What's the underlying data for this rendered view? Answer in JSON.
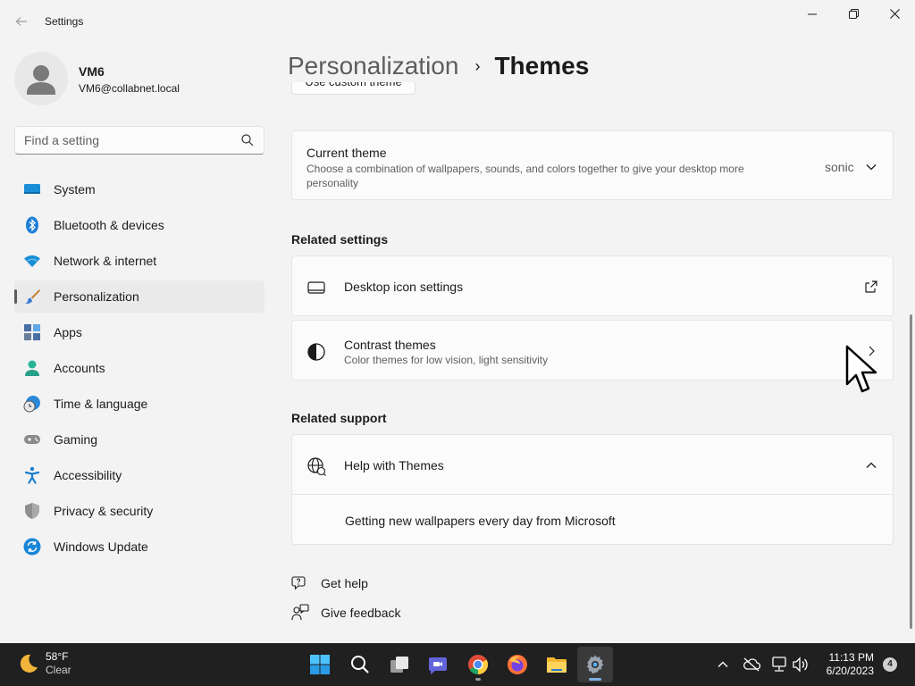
{
  "window": {
    "title": "Settings",
    "back_icon": "arrow-left-icon",
    "controls": [
      "minimize-icon",
      "maximize-icon",
      "close-icon"
    ]
  },
  "profile": {
    "name": "VM6",
    "email": "VM6@collabnet.local"
  },
  "search": {
    "placeholder": "Find a setting",
    "value": ""
  },
  "sidebar": {
    "items": [
      {
        "label": "System",
        "icon": "system-monitor-icon"
      },
      {
        "label": "Bluetooth & devices",
        "icon": "bluetooth-icon"
      },
      {
        "label": "Network & internet",
        "icon": "wifi-icon"
      },
      {
        "label": "Personalization",
        "icon": "paintbrush-icon",
        "active": true
      },
      {
        "label": "Apps",
        "icon": "apps-icon"
      },
      {
        "label": "Accounts",
        "icon": "accounts-icon"
      },
      {
        "label": "Time & language",
        "icon": "clock-globe-icon"
      },
      {
        "label": "Gaming",
        "icon": "gamepad-icon"
      },
      {
        "label": "Accessibility",
        "icon": "accessibility-icon"
      },
      {
        "label": "Privacy & security",
        "icon": "shield-icon"
      },
      {
        "label": "Windows Update",
        "icon": "update-icon"
      }
    ]
  },
  "header": {
    "parent": "Personalization",
    "separator": "›",
    "current": "Themes"
  },
  "main": {
    "custom_theme_button": "Use custom theme",
    "current_theme": {
      "title": "Current theme",
      "description": "Choose a combination of wallpapers, sounds, and colors together to give your desktop more personality",
      "value": "sonic"
    },
    "related_settings": {
      "heading": "Related settings",
      "items": [
        {
          "title": "Desktop icon settings",
          "icon": "desktop-icon",
          "end_icon": "open-external-icon"
        },
        {
          "title": "Contrast themes",
          "subtitle": "Color themes for low vision, light sensitivity",
          "icon": "contrast-icon",
          "end_icon": "chevron-right-icon"
        }
      ]
    },
    "related_support": {
      "heading": "Related support",
      "help_title": "Help with Themes",
      "expanded": true,
      "links": [
        "Getting new wallpapers every day from Microsoft"
      ]
    },
    "footer_links": [
      {
        "label": "Get help",
        "icon": "help-chat-icon"
      },
      {
        "label": "Give feedback",
        "icon": "feedback-icon"
      }
    ]
  },
  "taskbar": {
    "weather": {
      "temp": "58°F",
      "condition": "Clear"
    },
    "apps": [
      "start-icon",
      "search-icon",
      "task-view-icon",
      "teams-chat-icon",
      "chrome-icon",
      "firefox-icon",
      "file-explorer-icon",
      "settings-icon"
    ],
    "active_app": "settings-icon",
    "time": "11:13 PM",
    "date": "6/20/2023",
    "notification_count": "4"
  },
  "colors": {
    "background": "#f3f3f3",
    "card": "#fbfbfb",
    "taskbar": "#202020",
    "accent": "#0067c0"
  }
}
